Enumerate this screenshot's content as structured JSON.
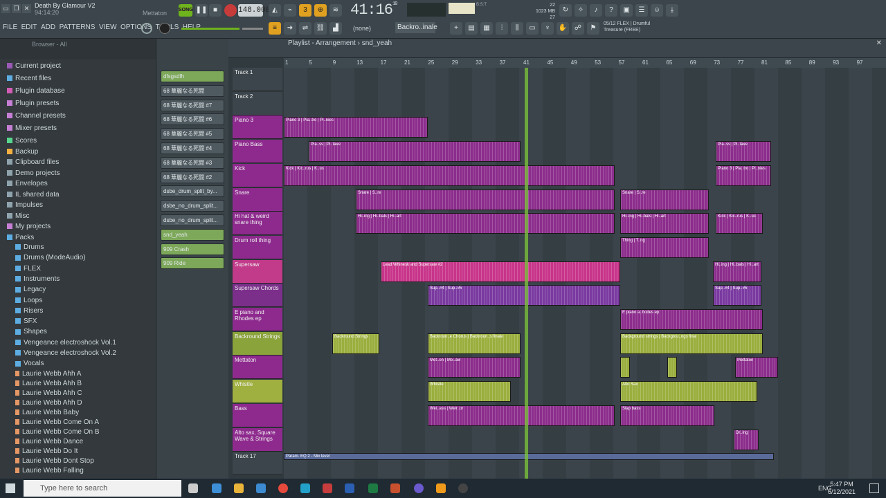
{
  "window": {
    "title": "Death By Glamour V2",
    "time": "94:14:20",
    "pattern_label": "Mettaton"
  },
  "transport": {
    "song": "SONG",
    "tempo": "148.000",
    "time": "41:16",
    "time_small": "10",
    "bars_beats": "B:S:T",
    "mem_lines": [
      "22",
      "1023 MB",
      "27"
    ]
  },
  "menu": [
    "FILE",
    "EDIT",
    "ADD",
    "PATTERNS",
    "VIEW",
    "OPTIONS",
    "TOOLS",
    "HELP"
  ],
  "pattern_select": "Backro..inale",
  "snap": "(none)",
  "hint": {
    "line1": "05/12 FLEX | Drumful",
    "line2": "Treasure (FREE)"
  },
  "browser": {
    "header": "Browser - All",
    "items": [
      "Current project",
      "Recent files",
      "Plugin database",
      "Plugin presets",
      "Channel presets",
      "Mixer presets",
      "Scores",
      "Backup",
      "Clipboard files",
      "Demo projects",
      "Envelopes",
      "IL shared data",
      "Impulses",
      "Misc",
      "My projects",
      "Packs"
    ],
    "packs": [
      "Drums",
      "Drums (ModeAudio)",
      "FLEX",
      "Instruments",
      "Legacy",
      "Loops",
      "Risers",
      "SFX",
      "Shapes",
      "Vengeance electroshock Vol.1",
      "Vengeance electroshock Vol.2",
      "Vocals"
    ],
    "vocals": [
      "Laurie Webb Ahh A",
      "Laurie Webb Ahh B",
      "Laurie Webb Ahh C",
      "Laurie Webb Ahh D",
      "Laurie Webb Baby",
      "Laurie Webb Come On A",
      "Laurie Webb Come On B",
      "Laurie Webb Dance",
      "Laurie Webb Do It",
      "Laurie Webb Dont Stop",
      "Laurie Webb Falling"
    ]
  },
  "channels": [
    "dfsgsdfh",
    "68 華麗なる死闘",
    "68 華麗なる死闘 #7",
    "68 華麗なる死闘 #6",
    "68 華麗なる死闘 #5",
    "68 華麗なる死闘 #4",
    "68 華麗なる死闘 #3",
    "68 華麗なる死闘 #2",
    "dsbe_drum_split_by...",
    "dsbe_no_drum_split...",
    "dsbe_no_drum_split...",
    "snd_yeah",
    "909 Crash",
    "909 Ride"
  ],
  "playlist": {
    "title": "Playlist - Arrangement",
    "pattern": "snd_yeah",
    "ruler": [
      "1",
      "5",
      "9",
      "13",
      "17",
      "21",
      "25",
      "29",
      "33",
      "37",
      "41",
      "45",
      "49",
      "53",
      "57",
      "61",
      "65",
      "69",
      "73",
      "77",
      "81",
      "85",
      "89",
      "93",
      "97"
    ],
    "tracks": [
      "Track 1",
      "Track 2",
      "Piano 3",
      "Piano Bass",
      "Kick",
      "Snare",
      "Hi hat & weird snare thing",
      "Drum roll thing",
      "Supersaw",
      "Supersaw Chords",
      "E piano and Rhodes ep",
      "Backround Strings",
      "Mettaton",
      "Whistle",
      "Bass",
      "Alto sax, Square Wave & Strings",
      "Track 17"
    ],
    "clips": {
      "piano3": "Piano 3 | Pia..tro | Pi..nies",
      "pianobass": "Pia..ss | Pi..tave",
      "kick": "Kick | Kic..rus | K..us",
      "snare": "Snare | S..re",
      "hihat": "Hi..ing | Hi..bals | Hi..art",
      "drumroll": "Thing | T..ng",
      "supersaw": "Lead Whinesk and Supersaw #2",
      "chords": "Sup..#4 | Sup..#5",
      "epiano": "E piano a..hodes ep",
      "strings1": "Backround Strings",
      "strings2": "Backroun..e Chorus | Backroun..s finale",
      "strings3": "Background strings | Backgrou..ngs final",
      "mettaton": "Met..on | Me..aw",
      "mettaton2": "Mettaton",
      "whistle": "Whistle",
      "altosax": "Alto Sax",
      "bass": "Wei..ass | Weir..or",
      "slap": "Slap bass",
      "dring": "Dr..ing",
      "param": "Param. EQ 2 - Mix level"
    }
  },
  "taskbar": {
    "search": "Type here to search",
    "time": "5:47 PM",
    "date": "6/12/2021",
    "lang": "ENG"
  }
}
